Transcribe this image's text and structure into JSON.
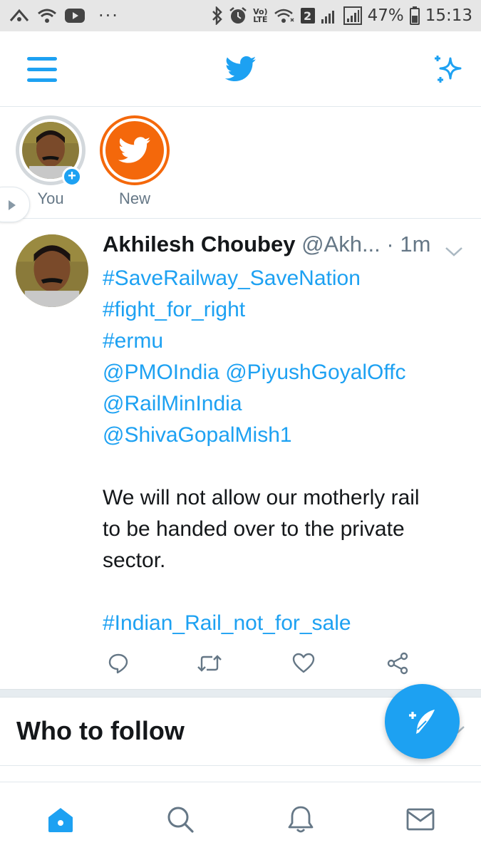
{
  "status_bar": {
    "volte_label": "Vo)\nLTE",
    "sim_badge": "2",
    "battery_percent": "47%",
    "time": "15:13",
    "icons": [
      "data-saver-icon",
      "wifi-icon",
      "youtube-icon",
      "more-dots-icon",
      "bluetooth-icon",
      "alarm-icon",
      "volte-icon",
      "wifi-icon",
      "signal-icon",
      "signal-icon",
      "battery-icon"
    ]
  },
  "app_bar": {
    "icons": [
      "menu-icon",
      "twitter-bird-icon",
      "sparkle-icon"
    ]
  },
  "fleets": {
    "items": [
      {
        "label": "You"
      },
      {
        "label": "New"
      }
    ]
  },
  "tweet": {
    "author": "Akhilesh Choubey",
    "handle": "@Akh...",
    "dot": " · ",
    "time": "1m",
    "lines": [
      "#SaveRailway_SaveNation",
      "#fight_for_right",
      "#ermu",
      "@PMOIndia",
      "@PiyushGoyalOffc",
      "@RailMinIndia",
      "@ShivaGopalMish1",
      "We will not allow our motherly rail",
      "to be handed over to the private",
      "sector.",
      "#Indian_Rail_not_for_sale"
    ],
    "actions": [
      "reply-icon",
      "retweet-icon",
      "like-icon",
      "share-icon"
    ]
  },
  "who_to_follow": {
    "title": "Who to follow"
  },
  "bottom_nav": {
    "items": [
      "home-icon",
      "search-icon",
      "notifications-icon",
      "messages-icon"
    ]
  },
  "colors": {
    "accent": "#1da1f2",
    "fleet_new": "#f4680b",
    "text": "#14171a",
    "secondary": "#657786"
  }
}
